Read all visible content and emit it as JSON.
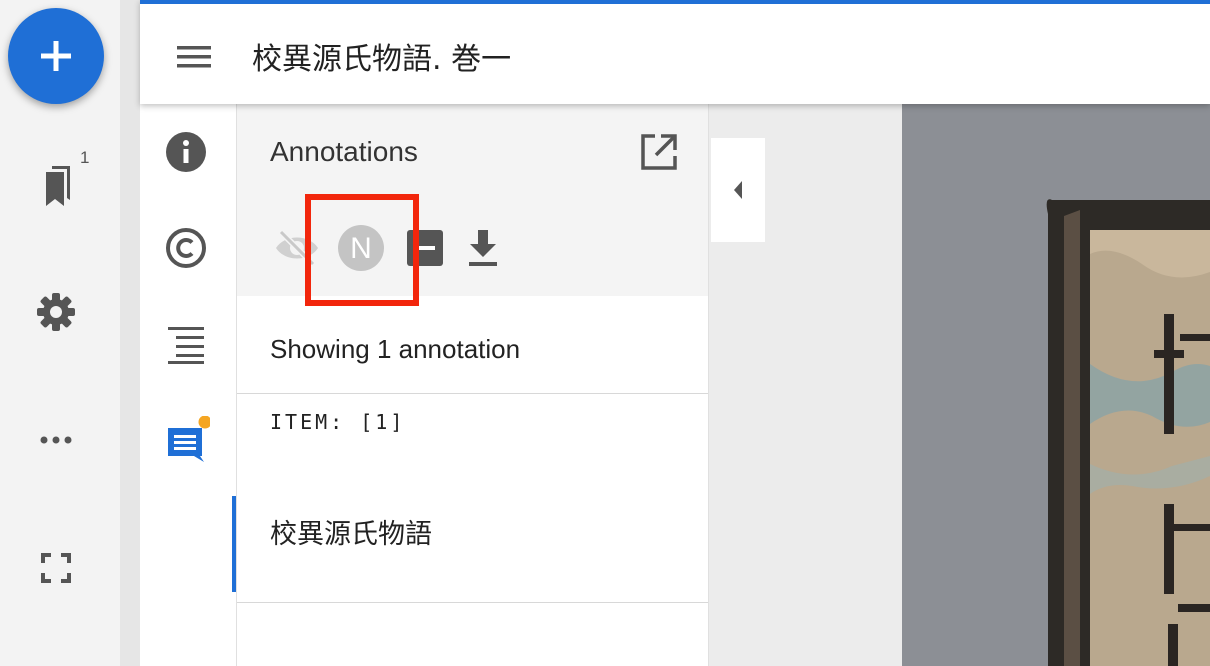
{
  "rail": {
    "bookmark_count": "1"
  },
  "window": {
    "title": "校異源氏物語. 巻一"
  },
  "panel": {
    "title": "Annotations",
    "tools": [
      "visibility-off-icon",
      "N",
      "minus-icon",
      "download-icon"
    ],
    "showing_text": "Showing 1 annotation",
    "item_label": "ITEM: [1]",
    "item_text": "校異源氏物語"
  },
  "colors": {
    "accent": "#1f6fd6",
    "highlight": "#f2260c",
    "notification_dot": "#f5a623"
  }
}
